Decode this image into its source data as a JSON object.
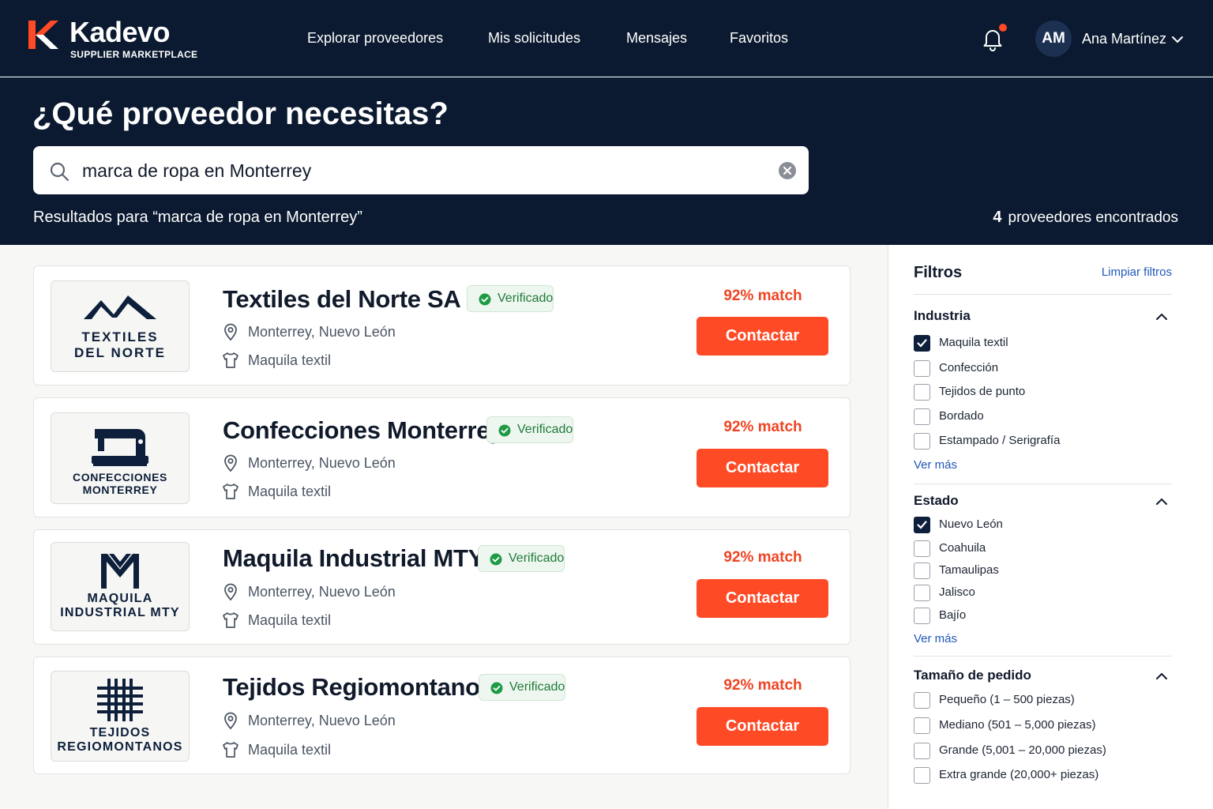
{
  "brand": {
    "name": "Kadevo",
    "tagline": "SUPPLIER MARKETPLACE",
    "accent": "#ff4a26",
    "navy": "#0b1a30"
  },
  "nav": {
    "links": [
      "Explorar proveedores",
      "Mis solicitudes",
      "Mensajes",
      "Favoritos"
    ],
    "notifications_icon": "bell-icon",
    "user": {
      "initials": "AM",
      "name": "Ana Martínez"
    }
  },
  "hero": {
    "title": "¿Qué proveedor necesitas?",
    "search_value": "marca de ropa en Monterrey",
    "results_for": "Resultados para “marca de ropa en Monterrey”",
    "results_count": "4",
    "results_count_label": "proveedores encontrados"
  },
  "suppliers": [
    {
      "name": "Textiles del Norte SA",
      "logo_text": [
        "TEXTILES",
        "DEL NORTE"
      ],
      "verified": "Verificado",
      "location": "Monterrey, Nuevo León",
      "category": "Maquila textil",
      "match": "92% match",
      "cta": "Contactar"
    },
    {
      "name": "Confecciones Monterrey",
      "logo_text": [
        "CONFECCIONES",
        "MONTERREY"
      ],
      "verified": "Verificado",
      "location": "Monterrey, Nuevo León",
      "category": "Maquila textil",
      "match": "92% match",
      "cta": "Contactar"
    },
    {
      "name": "Maquila Industrial MTY",
      "logo_text": [
        "MAQUILA",
        "INDUSTRIAL MTY"
      ],
      "verified": "Verificado",
      "location": "Monterrey, Nuevo León",
      "category": "Maquila textil",
      "match": "92% match",
      "cta": "Contactar"
    },
    {
      "name": "Tejidos Regiomontanos",
      "logo_text": [
        "TEJIDOS",
        "REGIOMONTANOS"
      ],
      "verified": "Verificado",
      "location": "Monterrey, Nuevo León",
      "category": "Maquila textil",
      "match": "92% match",
      "cta": "Contactar"
    }
  ],
  "filters": {
    "title": "Filtros",
    "clear": "Limpiar filtros",
    "groups": [
      {
        "title": "Industria",
        "see_more": "Ver más",
        "options": [
          {
            "label": "Maquila textil",
            "checked": true
          },
          {
            "label": "Confección",
            "checked": false
          },
          {
            "label": "Tejidos de punto",
            "checked": false
          },
          {
            "label": "Bordado",
            "checked": false
          },
          {
            "label": "Estampado / Serigrafía",
            "checked": false
          }
        ]
      },
      {
        "title": "Estado",
        "see_more": "Ver más",
        "options": [
          {
            "label": "Nuevo León",
            "checked": true
          },
          {
            "label": "Coahuila",
            "checked": false
          },
          {
            "label": "Tamaulipas",
            "checked": false
          },
          {
            "label": "Jalisco",
            "checked": false
          },
          {
            "label": "Bajío",
            "checked": false
          }
        ]
      },
      {
        "title": "Tamaño de pedido",
        "options": [
          {
            "label": "Pequeño (1 – 500 piezas)",
            "checked": false
          },
          {
            "label": "Mediano (501 – 5,000 piezas)",
            "checked": false
          },
          {
            "label": "Grande (5,001 – 20,000 piezas)",
            "checked": false
          },
          {
            "label": "Extra grande (20,000+ piezas)",
            "checked": false
          }
        ]
      }
    ]
  }
}
